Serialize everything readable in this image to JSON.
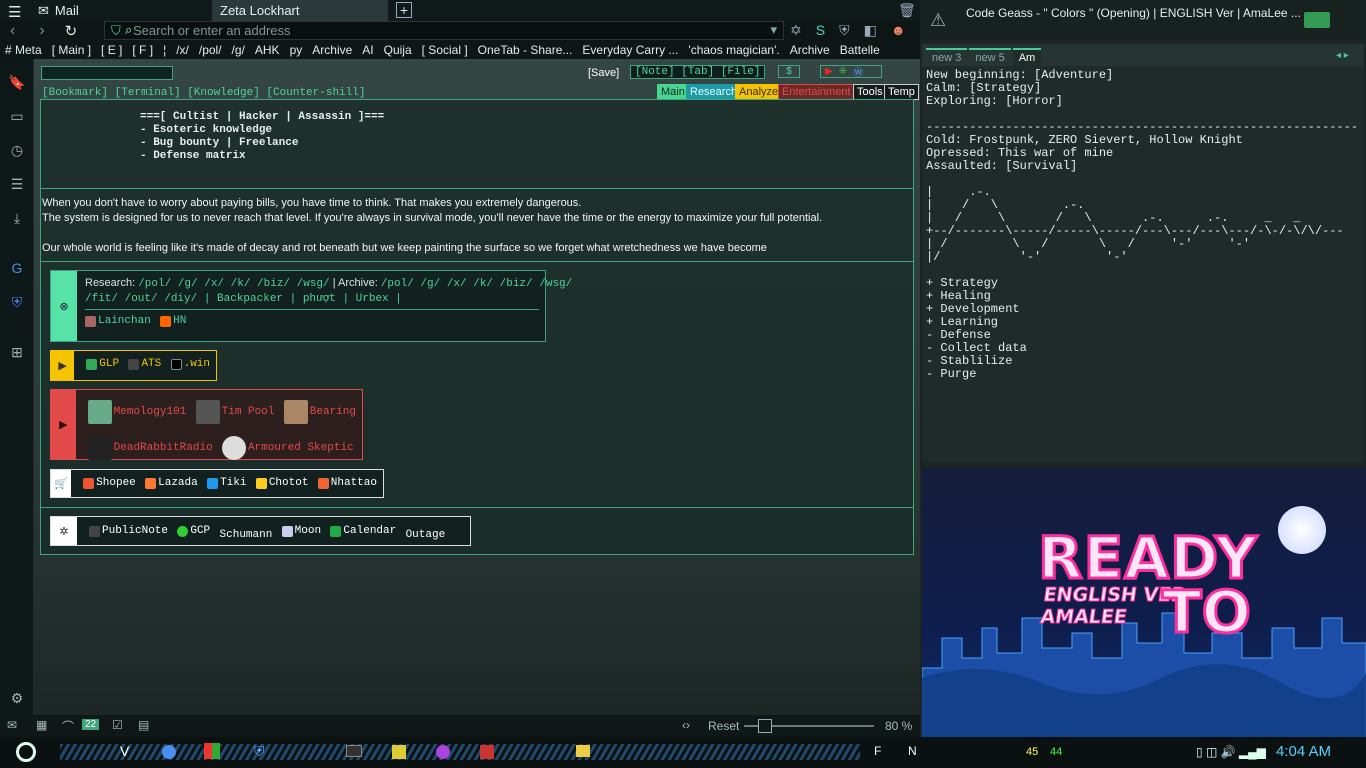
{
  "browser": {
    "tabs": [
      {
        "label": "Mail"
      },
      {
        "label": "Zeta Lockhart"
      }
    ],
    "address_placeholder": "Search or enter an address",
    "bookmarks": [
      "# Meta",
      "[ Main ]",
      "[ E ]",
      "[ F ]",
      "¦",
      "/x/",
      "/pol/",
      "/g/",
      "AHK",
      "py",
      "Archive",
      "AI",
      "Quija",
      "[ Social ]",
      "OneTab - Share...",
      "Everyday Carry ...",
      "'chaos magician'.",
      "Archive",
      "Battelle"
    ]
  },
  "page": {
    "save_label": "[Save]",
    "top_links": "[Note] [Tab] [File]",
    "header_links": "[Bookmark] [Terminal] [Knowledge] [Counter-shill]",
    "nav_tabs": [
      "Main",
      "Research",
      "Analyze",
      "Entertainment",
      "Tools",
      "Temp"
    ],
    "ascii_block": "===[ Cultist | Hacker | Assassin ]===\n- Esoteric knowledge\n- Bug bounty | Freelance\n- Defense matrix",
    "quotes": [
      "When you don't have to worry about paying bills, you have time to think. That makes you extremely dangerous.",
      "The system is designed for us to never reach that level. If you're always in survival mode, you'll never have the time or the energy to maximize your full potential.",
      "Our whole world is feeling like it's made of decay and rot beneath but we keep painting the surface so we forget what wretchedness we have become"
    ],
    "research_label": "Research:",
    "research_links": "/pol/ /g/ /x/ /k/ /biz/ /wsg/",
    "archive_label": "| Archive:",
    "archive_links": "/pol/ /g/ /x/ /k/ /biz/ /wsg/",
    "research_row2": "/fit/ /out/ /diy/ | Backpacker | phượt | Urbex |",
    "box1_chips": [
      "Lainchan",
      "HN"
    ],
    "box2_chips": [
      "GLP",
      "ATS",
      ".win"
    ],
    "box3_chips": [
      "Memology101",
      "Tim Pool",
      "Bearing",
      "DeadRabbitRadio",
      "Armoured Skeptic"
    ],
    "box4_chips": [
      "Shopee",
      "Lazada",
      "Tiki",
      "Chotot",
      "Nhattao"
    ],
    "box5_chips": [
      "PublicNote",
      "GCP",
      "Schumann",
      "Moon",
      "Calendar",
      "Outage"
    ]
  },
  "status": {
    "reset_label": "Reset",
    "zoom": "80 %",
    "badge": "22"
  },
  "right": {
    "window_title": "Code Geass - \" Colors \" (Opening)  | ENGLISH Ver  |  AmaLee ...",
    "note_tabs": [
      "new 3",
      "new 5",
      "Am"
    ],
    "notes_text": "New beginning: [Adventure]\nCalm: [Strategy]\nExploring: [Horror]\n\n------------------------------------------------------------\nCold: Frostpunk, ZERO Sievert, Hollow Knight\nOpressed: This war of mine\nAssaulted: [Survival]\n\n|     .-.\n|    /   \\         .-.\n|   /     \\       /   \\       .-.      .-.     _   _\n+--/-------\\-----/-----\\-----/---\\---/---\\---/-\\-/-\\/\\/---\n| /         \\   /       \\   /     '-'     '-'\n|/           '-'         '-'\n\n+ Strategy\n+ Healing\n+ Development\n+ Learning\n- Defense\n- Collect data\n- Stablilize\n- Purge",
    "video_title_1": "READY",
    "video_title_2": "TO",
    "video_subtitle": "ENGLISH VER\nAMALEE"
  },
  "taskbar": {
    "clock": "4:04 AM",
    "cpu": "45",
    "mem": "44",
    "letters": [
      "F",
      "N"
    ]
  },
  "colors": {
    "accent": "#3fa57c",
    "link": "#4fd39a",
    "yellow": "#f5c400",
    "red": "#e24a4a",
    "pink": "#ff2e9f"
  }
}
